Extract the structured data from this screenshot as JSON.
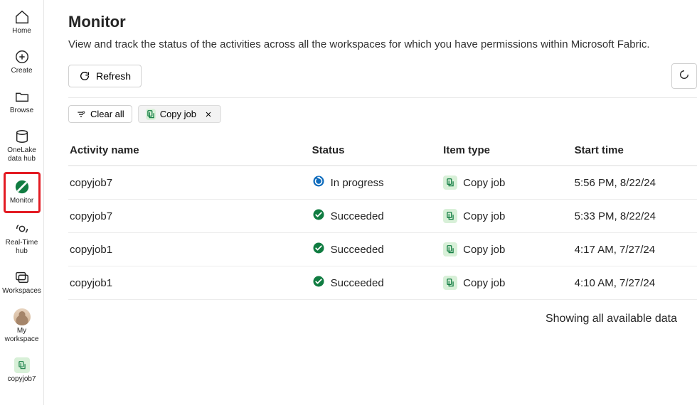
{
  "sidebar": {
    "items": [
      {
        "label": "Home"
      },
      {
        "label": "Create"
      },
      {
        "label": "Browse"
      },
      {
        "label": "OneLake data hub"
      },
      {
        "label": "Monitor"
      },
      {
        "label": "Real-Time hub"
      },
      {
        "label": "Workspaces"
      },
      {
        "label": "My workspace"
      },
      {
        "label": "copyjob7"
      }
    ]
  },
  "page": {
    "title": "Monitor",
    "subtitle": "View and track the status of the activities across all the workspaces for which you have permissions within Microsoft Fabric."
  },
  "toolbar": {
    "refresh": "Refresh",
    "clearAll": "Clear all",
    "filterChip": "Copy job"
  },
  "table": {
    "headers": {
      "activity": "Activity name",
      "status": "Status",
      "itemType": "Item type",
      "startTime": "Start time"
    },
    "rows": [
      {
        "activity": "copyjob7",
        "status": "In progress",
        "statusKind": "progress",
        "itemType": "Copy job",
        "startTime": "5:56 PM, 8/22/24"
      },
      {
        "activity": "copyjob7",
        "status": "Succeeded",
        "statusKind": "success",
        "itemType": "Copy job",
        "startTime": "5:33 PM, 8/22/24"
      },
      {
        "activity": "copyjob1",
        "status": "Succeeded",
        "statusKind": "success",
        "itemType": "Copy job",
        "startTime": "4:17 AM, 7/27/24"
      },
      {
        "activity": "copyjob1",
        "status": "Succeeded",
        "statusKind": "success",
        "itemType": "Copy job",
        "startTime": "4:10 AM, 7/27/24"
      }
    ]
  },
  "footer": {
    "message": "Showing all available data"
  },
  "colors": {
    "success": "#107c41",
    "progress": "#0f6cbd",
    "highlight": "#e31b23"
  }
}
